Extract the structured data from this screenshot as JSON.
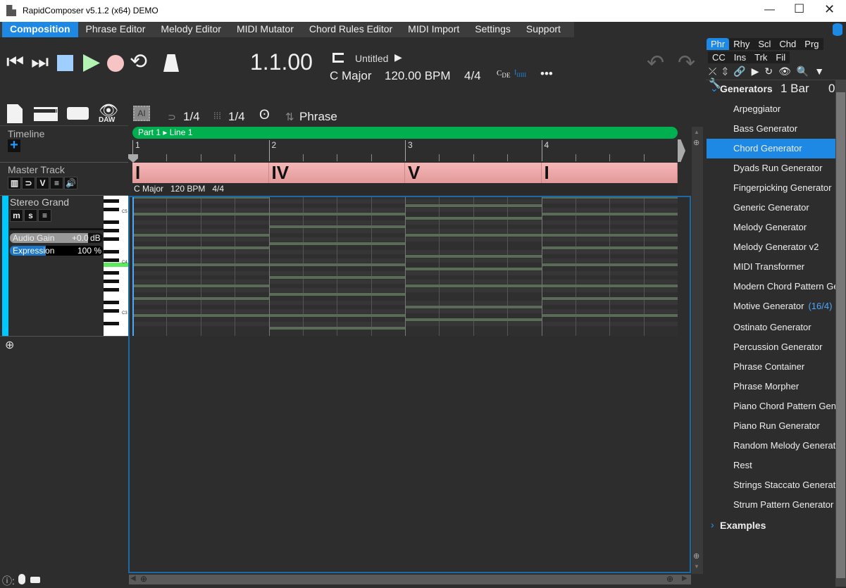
{
  "window": {
    "title": "RapidComposer v5.1.2 (x64) DEMO"
  },
  "menu": [
    "Composition",
    "Phrase Editor",
    "Melody Editor",
    "MIDI Mutator",
    "Chord Rules Editor",
    "MIDI Import",
    "Settings",
    "Support"
  ],
  "transport": {
    "position": "1.1.00",
    "song_name": "Untitled",
    "key": "C Major",
    "tempo": "120.00 BPM",
    "time_sig": "4/4",
    "more": "•••"
  },
  "toolbar2": {
    "daw_label": "DAW",
    "ai_label": "AI",
    "snap": "1/4",
    "grid": "1/4",
    "mode": "Phrase"
  },
  "left": {
    "timeline": "Timeline",
    "master_track": "Master Track",
    "track_name": "Stereo Grand",
    "audio_gain_label": "Audio Gain",
    "audio_gain_value": "+0.0",
    "audio_gain_unit": "dB",
    "expression_label": "Expression",
    "expression_value": "100 %",
    "expression_fraction": 0.39,
    "piano_labels": [
      "C5",
      "C4",
      "C3"
    ]
  },
  "timeline": {
    "part_label": "Part 1 ▸ Line 1",
    "bars": [
      "1",
      "2",
      "3",
      "4"
    ],
    "chords": [
      "I",
      "IV",
      "V",
      "I"
    ],
    "info": "C Major   120 BPM   4/4"
  },
  "notes": [
    [
      76,
      72,
      67,
      64,
      60,
      55,
      52,
      48
    ],
    [
      77,
      72,
      69,
      65,
      60,
      57,
      53,
      48,
      45
    ],
    [
      74,
      71,
      67,
      62,
      59,
      55,
      50,
      47
    ],
    [
      76,
      72,
      67,
      64,
      60,
      55,
      52,
      48
    ]
  ],
  "right": {
    "tabs_row1": [
      "Phr",
      "Rhy",
      "Scl",
      "Chd",
      "Prg"
    ],
    "tabs_row2": [
      "CC",
      "Ins",
      "Trk",
      "Fil"
    ],
    "generators_label": "Generators",
    "length": "1 Bar",
    "col3": "0",
    "items": [
      "Arpeggiator",
      "Bass Generator",
      "Chord Generator",
      "Dyads Run Generator",
      "Fingerpicking Generator",
      "Generic Generator",
      "Melody Generator",
      "Melody Generator v2",
      "MIDI Transformer",
      "Modern Chord Pattern Generator",
      "Motive Generator",
      "Ostinato Generator",
      "Percussion Generator",
      "Phrase Container",
      "Phrase Morpher",
      "Piano Chord Pattern Generator",
      "Piano Run Generator",
      "Random Melody Generator",
      "Rest",
      "Strings Staccato Generator",
      "Strum Pattern Generator"
    ],
    "motive_extra": "(16/4)",
    "examples_label": "Examples",
    "selected": "Chord Generator"
  },
  "colors": {
    "accent": "#1e88e5",
    "part": "#00b050",
    "chord": "#f2adad",
    "track": "#00c8ff"
  }
}
